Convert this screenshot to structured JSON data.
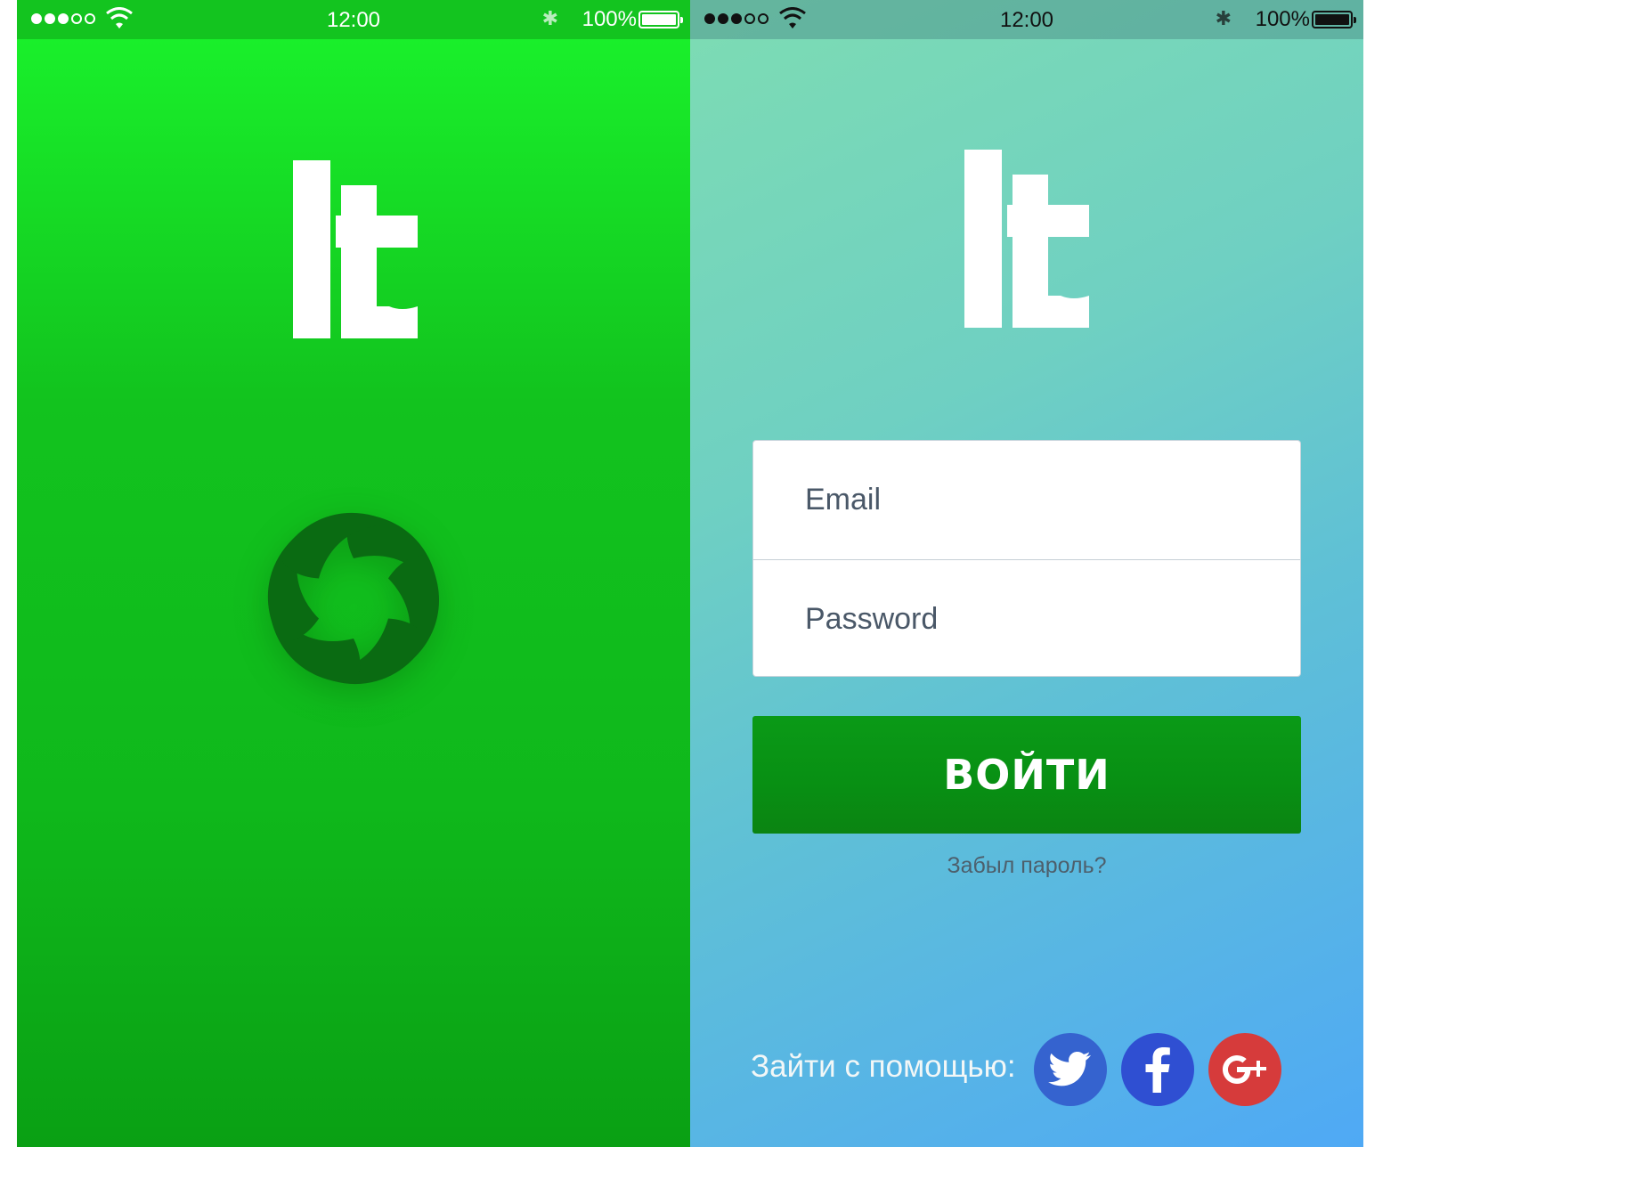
{
  "splash": {
    "status_bar": {
      "time": "12:00",
      "battery": "100%"
    },
    "colors": {
      "background_top": "#1af42c",
      "background_bottom": "#0aa014",
      "spinner": "#0a6b12"
    },
    "logo_icon": "lt-logo",
    "spinner_icon": "swirl-spinner-icon"
  },
  "login": {
    "status_bar": {
      "time": "12:00",
      "battery": "100%"
    },
    "colors": {
      "background_top": "#7ddcb3",
      "background_bottom": "#4fa9f5",
      "button": "#0a9a17",
      "twitter": "#3563cf",
      "facebook": "#2f4fd2",
      "google": "#d63b3b"
    },
    "logo_icon": "lt-logo",
    "email": {
      "placeholder": "Email",
      "value": ""
    },
    "password": {
      "placeholder": "Password",
      "value": ""
    },
    "submit_label": "ВОЙТИ",
    "forgot_label": "Забыл пароль?",
    "social": {
      "label": "Зайти с помощью:",
      "providers": [
        "twitter-icon",
        "facebook-icon",
        "google-plus-icon"
      ]
    }
  }
}
